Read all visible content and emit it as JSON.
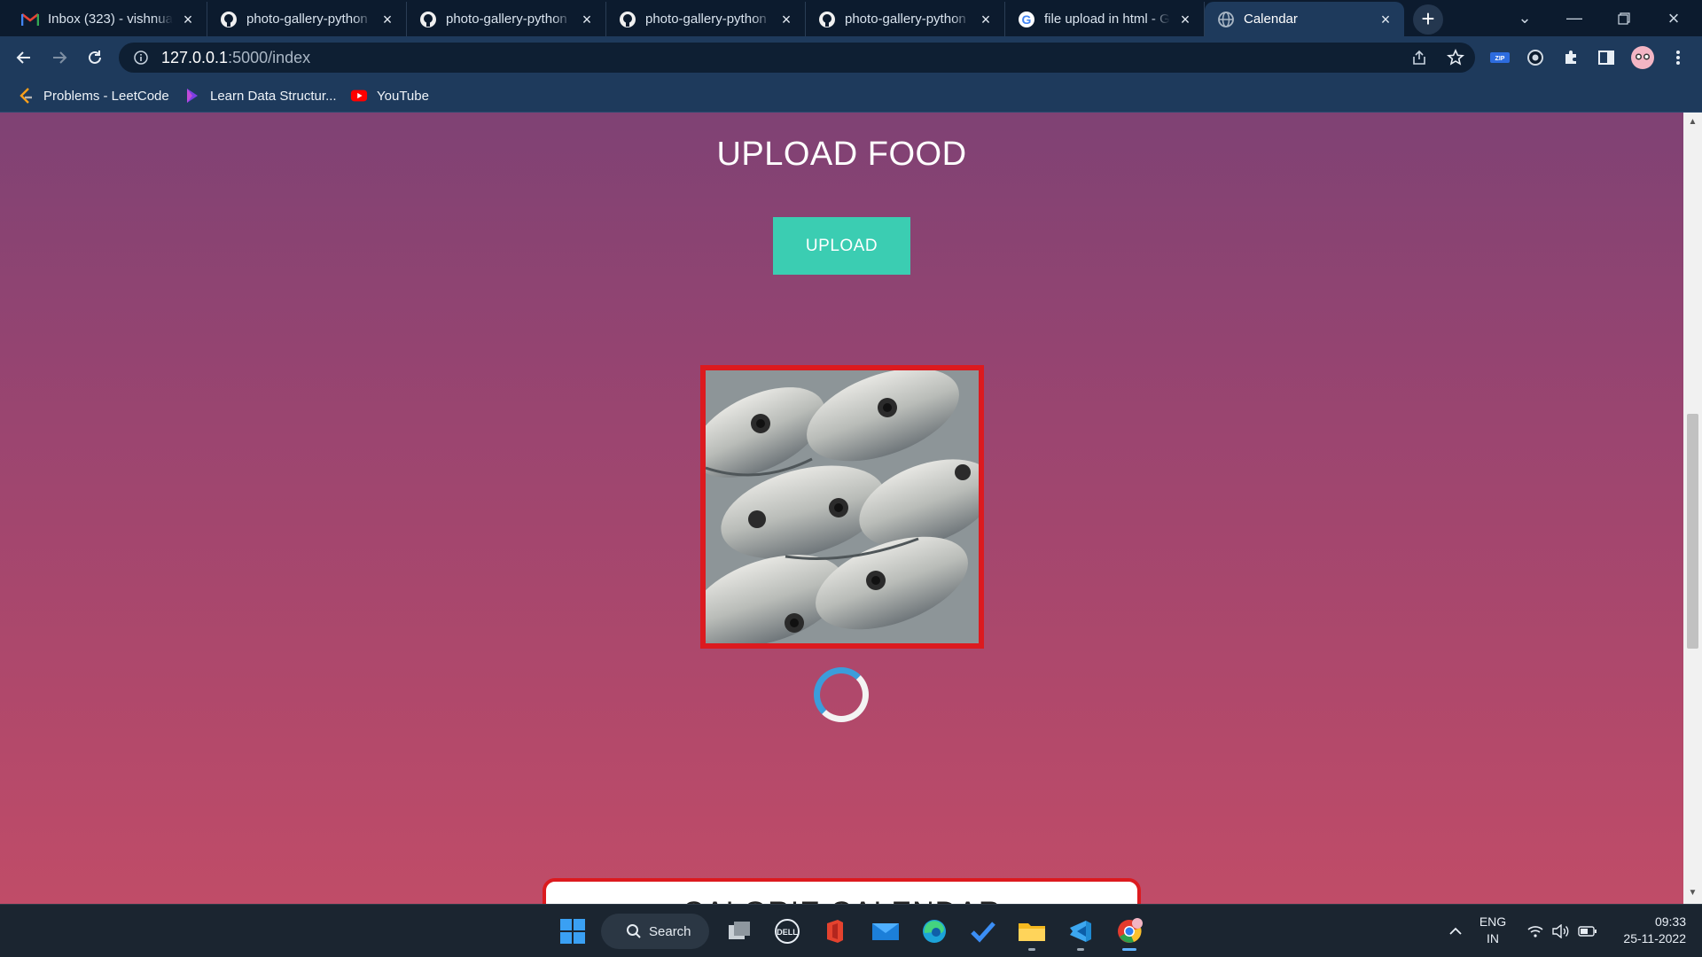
{
  "browser": {
    "tabs": [
      {
        "title": "Inbox (323) - vishnua",
        "icon": "gmail-icon",
        "active": false
      },
      {
        "title": "photo-gallery-python",
        "icon": "github-icon",
        "active": false
      },
      {
        "title": "photo-gallery-python",
        "icon": "github-icon",
        "active": false
      },
      {
        "title": "photo-gallery-python",
        "icon": "github-icon",
        "active": false
      },
      {
        "title": "photo-gallery-python",
        "icon": "github-icon",
        "active": false
      },
      {
        "title": "file upload in html - G",
        "icon": "google-icon",
        "active": false
      },
      {
        "title": "Calendar",
        "icon": "globe-icon",
        "active": true
      }
    ],
    "url": {
      "host": "127.0.0.1",
      "path": ":5000/index"
    },
    "bookmarks": [
      {
        "label": "Problems - LeetCode",
        "icon": "leetcode-icon"
      },
      {
        "label": "Learn Data Structur...",
        "icon": "learn-icon"
      },
      {
        "label": "YouTube",
        "icon": "youtube-icon"
      }
    ]
  },
  "page": {
    "title": "UPLOAD FOOD",
    "upload_label": "UPLOAD",
    "calendar_title": "CALORIE CALENDAR"
  },
  "taskbar": {
    "search_label": "Search",
    "lang_line1": "ENG",
    "lang_line2": "IN",
    "time": "09:33",
    "date": "25-11-2022"
  },
  "colors": {
    "accent_teal": "#3bcdb2",
    "border_red": "#dc1a1f",
    "spinner_blue": "#3b9ddb",
    "gradient_top": "#7f4274",
    "gradient_bottom": "#c04c68"
  }
}
